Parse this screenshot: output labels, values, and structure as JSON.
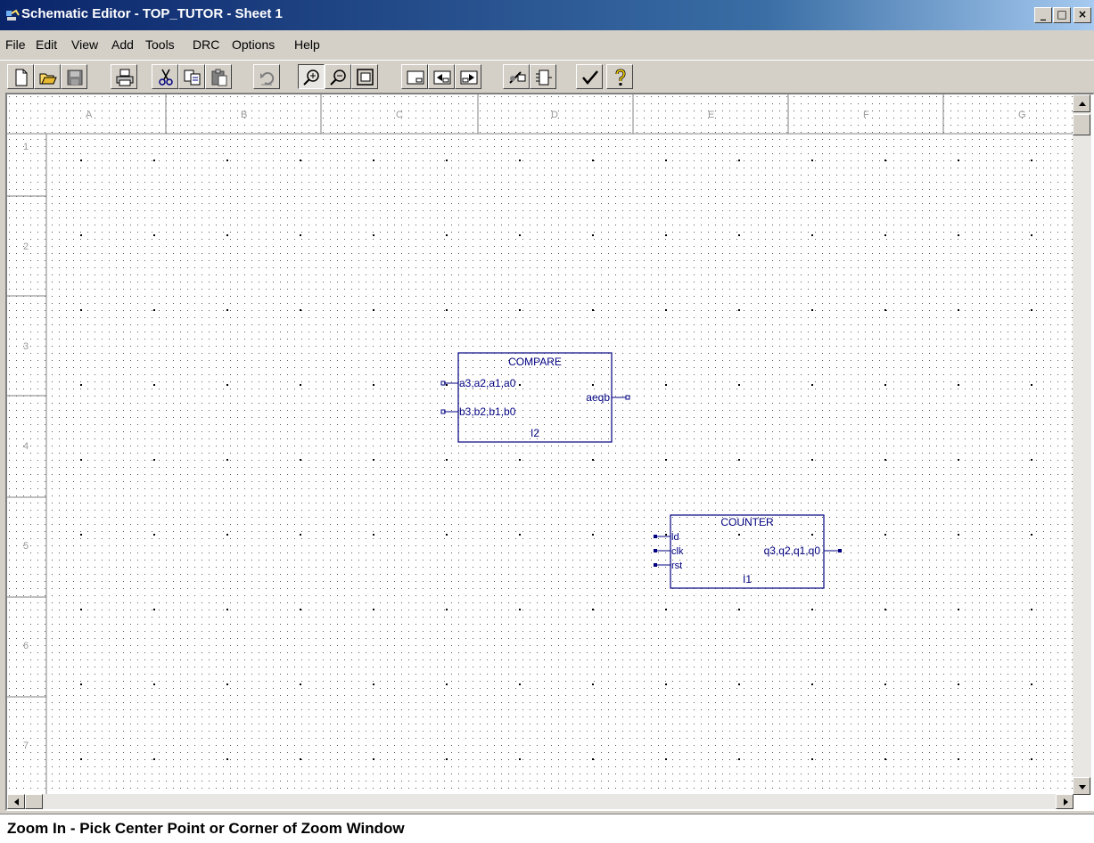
{
  "window": {
    "title": "Schematic Editor - TOP_TUTOR - Sheet 1",
    "controls": {
      "minimize": "_",
      "maximize": "□",
      "close": "×"
    }
  },
  "menu": {
    "items": [
      "File",
      "Edit",
      "View",
      "Add",
      "Tools",
      "DRC",
      "Options",
      "Help"
    ]
  },
  "toolbar": {
    "buttons": [
      "new-icon",
      "open-icon",
      "save-icon",
      "print-icon",
      "cut-icon",
      "copy-icon",
      "paste-icon",
      "undo-icon",
      "zoom-in-icon",
      "zoom-out-icon",
      "zoom-fit-icon",
      "sheet-icon",
      "prev-sheet-icon",
      "next-sheet-icon",
      "hierarchy-icon",
      "symbol-icon",
      "check-icon",
      "help-icon"
    ],
    "active": "zoom-in-icon"
  },
  "sheet": {
    "columns": [
      "A",
      "B",
      "C",
      "D",
      "E",
      "F",
      "G"
    ],
    "rows": [
      "1",
      "2",
      "3",
      "4",
      "5",
      "6",
      "7"
    ],
    "colors": {
      "border": "#000080",
      "grid": "#000000",
      "component": "#000080",
      "pin_open": "#000080"
    }
  },
  "components": {
    "compare": {
      "name": "COMPARE",
      "instance": "I2",
      "inputs": [
        "a3,a2,a1,a0",
        "b3,b2,b1,b0"
      ],
      "outputs": [
        "aeqb"
      ]
    },
    "counter": {
      "name": "COUNTER",
      "instance": "I1",
      "inputs": [
        "ld",
        "clk",
        "rst"
      ],
      "outputs": [
        "q3,q2,q1,q0"
      ]
    }
  },
  "status": {
    "message": "Zoom In - Pick Center Point or Corner of Zoom Window"
  }
}
